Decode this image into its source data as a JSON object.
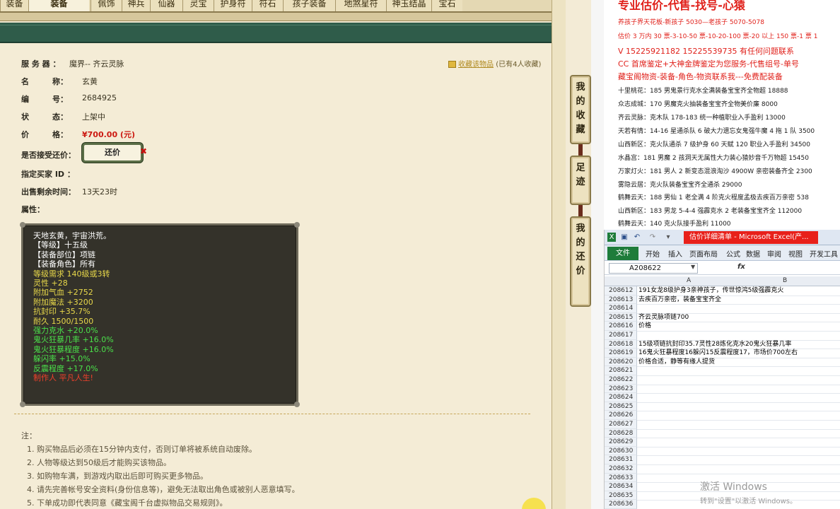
{
  "top_nav": {
    "tabs": [
      "装备",
      "装备",
      "佩饰",
      "神兵",
      "仙器",
      "灵宝",
      "护身符",
      "符石",
      "孩子装备",
      "地煞星符",
      "神玉结晶",
      "宝石"
    ]
  },
  "listing": {
    "fields": [
      {
        "label": "服 务 器 ：",
        "value": "魔界-- 齐云灵脉"
      },
      {
        "label": "名　　　称：",
        "value": "玄黄"
      },
      {
        "label": "编　　　号：",
        "value": "2684925"
      },
      {
        "label": "状　　　态：",
        "value": "上架中"
      },
      {
        "label": "价　　　格：",
        "value": "¥700.00 (元)"
      }
    ],
    "accept_bargain_label": "是否接受还价：",
    "bargain_button": "还价",
    "bargain_mark": "✖",
    "buyer_id_label": "指定买家 ID ：",
    "remaining_label": "出售剩余时间：",
    "remaining_value": "13天23时",
    "attr_label": "属性：",
    "favorite_link": "收藏该物品",
    "favorite_count": "(已有4人收藏)"
  },
  "attributes": [
    {
      "text": "天地玄黄，宇宙洪荒。",
      "color": "#ffffff"
    },
    {
      "text": "【等级】十五级",
      "color": "#ffffff"
    },
    {
      "text": "【装备部位】项链",
      "color": "#ffffff"
    },
    {
      "text": "【装备角色】所有",
      "color": "#ffffff"
    },
    {
      "text": "等级需求 140级或3转",
      "color": "#e8d84a"
    },
    {
      "text": "灵性 +28",
      "color": "#e8d84a"
    },
    {
      "text": "附加气血 +2752",
      "color": "#e8d84a"
    },
    {
      "text": "附加魔法 +3200",
      "color": "#e8d84a"
    },
    {
      "text": "抗封印 +35.7%",
      "color": "#e8d84a"
    },
    {
      "text": "耐久 1500/1500",
      "color": "#e8d84a"
    },
    {
      "text": "强力克水 +20.0%",
      "color": "#4ae04a"
    },
    {
      "text": "鬼火狂暴几率 +16.0%",
      "color": "#4ae04a"
    },
    {
      "text": "鬼火狂暴程度 +16.0%",
      "color": "#4ae04a"
    },
    {
      "text": "躲闪率 +15.0%",
      "color": "#4ae04a"
    },
    {
      "text": "反震程度 +17.0%",
      "color": "#4ae04a"
    },
    {
      "text": "制作人 平凡人生!",
      "color": "#f0402a"
    }
  ],
  "notes": {
    "title": "注：",
    "items": [
      "1. 购买物品后必须在15分钟内支付，否则订单将被系统自动废除。",
      "2. 人物等级达到50级后才能购买该物品。",
      "3. 如购物车满，到游戏内取出后即可购买更多物品。",
      "4. 请先完善帐号安全资料(身份信息等)，避免无法取出角色或被别人恶意填写。",
      "5. 下单成功即代表同意《藏宝阁千台虚拟物品交易规则》。"
    ]
  },
  "side_buttons": [
    "我的收藏",
    "足迹",
    "我的还价"
  ],
  "ad_panel": {
    "headline": "专业估价-代售-找号-心猿",
    "lines": [
      {
        "text": "养孩子界天花板-新孩子 5030—老孩子 5070-5078",
        "red": true
      },
      {
        "text": "估价 3 万内 30 票-3-10-50 票-10-20-100 票-20 以上 150 票-1 票 1",
        "red": true
      },
      {
        "text": "V 15225921182    15225539735 有任何问题联系",
        "red": true,
        "big": true
      },
      {
        "text": "CC 首席鉴定+大神金牌鉴定为您服务-代售组号-单号",
        "red": true,
        "big": true
      },
      {
        "text": "藏宝阁物资-装备-角色-物资联系我---免费配装备",
        "red": true,
        "big": true
      },
      {
        "text": "十里桃花：185 男鬼景行克水全满装备宝宝齐全物超 18888",
        "red": false
      },
      {
        "text": "众志成城：170 男魔克火抽装备宝宝齐全物美价廉 8000",
        "red": false
      },
      {
        "text": "齐云灵脉：克木队 178-183 统一种植职业入手盈利 13000",
        "red": false
      },
      {
        "text": "天若有情：14-16 星通杀队 6 破大力遗忘女鬼强牛魔 4 拖 1 队 3500",
        "red": false
      },
      {
        "text": "山西新区：克火队通杀 7 级护身 60 天赋 120 职业入手盈利 34500",
        "red": false
      },
      {
        "text": "水晶宫：181 男魔 2 孩洞天无属性大力装心猿妙音千万物超 15450",
        "red": false
      },
      {
        "text": "万家灯火：181 男人 2 新变态混浪淘沙 4900W 亲密装备齐全 2300",
        "red": false
      },
      {
        "text": "雾隐云居：克火队装备宝宝齐全通杀 29000",
        "red": false
      },
      {
        "text": "鹤舞云天：188 男仙 1 老全满 4 阶克火程度孟极去疾百万亲密 538",
        "red": false
      },
      {
        "text": "山西新区：183 男龙 5-4-4 强霹克水 2 老装备宝宝齐全 112000",
        "red": false
      },
      {
        "text": "鹤舞云天：140 克火队接手盈利 11000",
        "red": false
      }
    ]
  },
  "excel": {
    "title": "估价详细清单 - Microsoft Excel(产...",
    "ribbon_tabs": [
      "文件",
      "开始",
      "插入",
      "页面布局",
      "公式",
      "数据",
      "审阅",
      "视图",
      "开发工具"
    ],
    "name_box": "A208622",
    "fx": "fx",
    "col_a": "A",
    "col_b": "B",
    "rows": [
      {
        "n": "208612",
        "text": "191女龙8级护身3亲神孩子，传世惊鸿5级强霹克火"
      },
      {
        "n": "208613",
        "text": "去疾百万亲密，装备宝宝齐全"
      },
      {
        "n": "208614",
        "text": ""
      },
      {
        "n": "208615",
        "text": "齐云灵脉项链700"
      },
      {
        "n": "208616",
        "text": "价格"
      },
      {
        "n": "208617",
        "text": ""
      },
      {
        "n": "208618",
        "text": "15级项链抗封印35.7灵性28炼化克水20鬼火狂暴几率"
      },
      {
        "n": "208619",
        "text": "16鬼火狂暴程度16躲闪15反震程度17，市场价700左右"
      },
      {
        "n": "208620",
        "text": "价格合适，静等有缘人提货"
      },
      {
        "n": "208621",
        "text": ""
      },
      {
        "n": "208622",
        "text": ""
      },
      {
        "n": "208623",
        "text": ""
      },
      {
        "n": "208624",
        "text": ""
      },
      {
        "n": "208625",
        "text": ""
      },
      {
        "n": "208626",
        "text": ""
      },
      {
        "n": "208627",
        "text": ""
      },
      {
        "n": "208628",
        "text": ""
      },
      {
        "n": "208629",
        "text": ""
      },
      {
        "n": "208630",
        "text": ""
      },
      {
        "n": "208631",
        "text": ""
      },
      {
        "n": "208632",
        "text": ""
      },
      {
        "n": "208633",
        "text": ""
      },
      {
        "n": "208634",
        "text": ""
      },
      {
        "n": "208635",
        "text": ""
      },
      {
        "n": "208636",
        "text": ""
      }
    ]
  },
  "watermark": {
    "line1": "激活 Windows",
    "line2": "转到\"设置\"以激活 Windows。"
  }
}
